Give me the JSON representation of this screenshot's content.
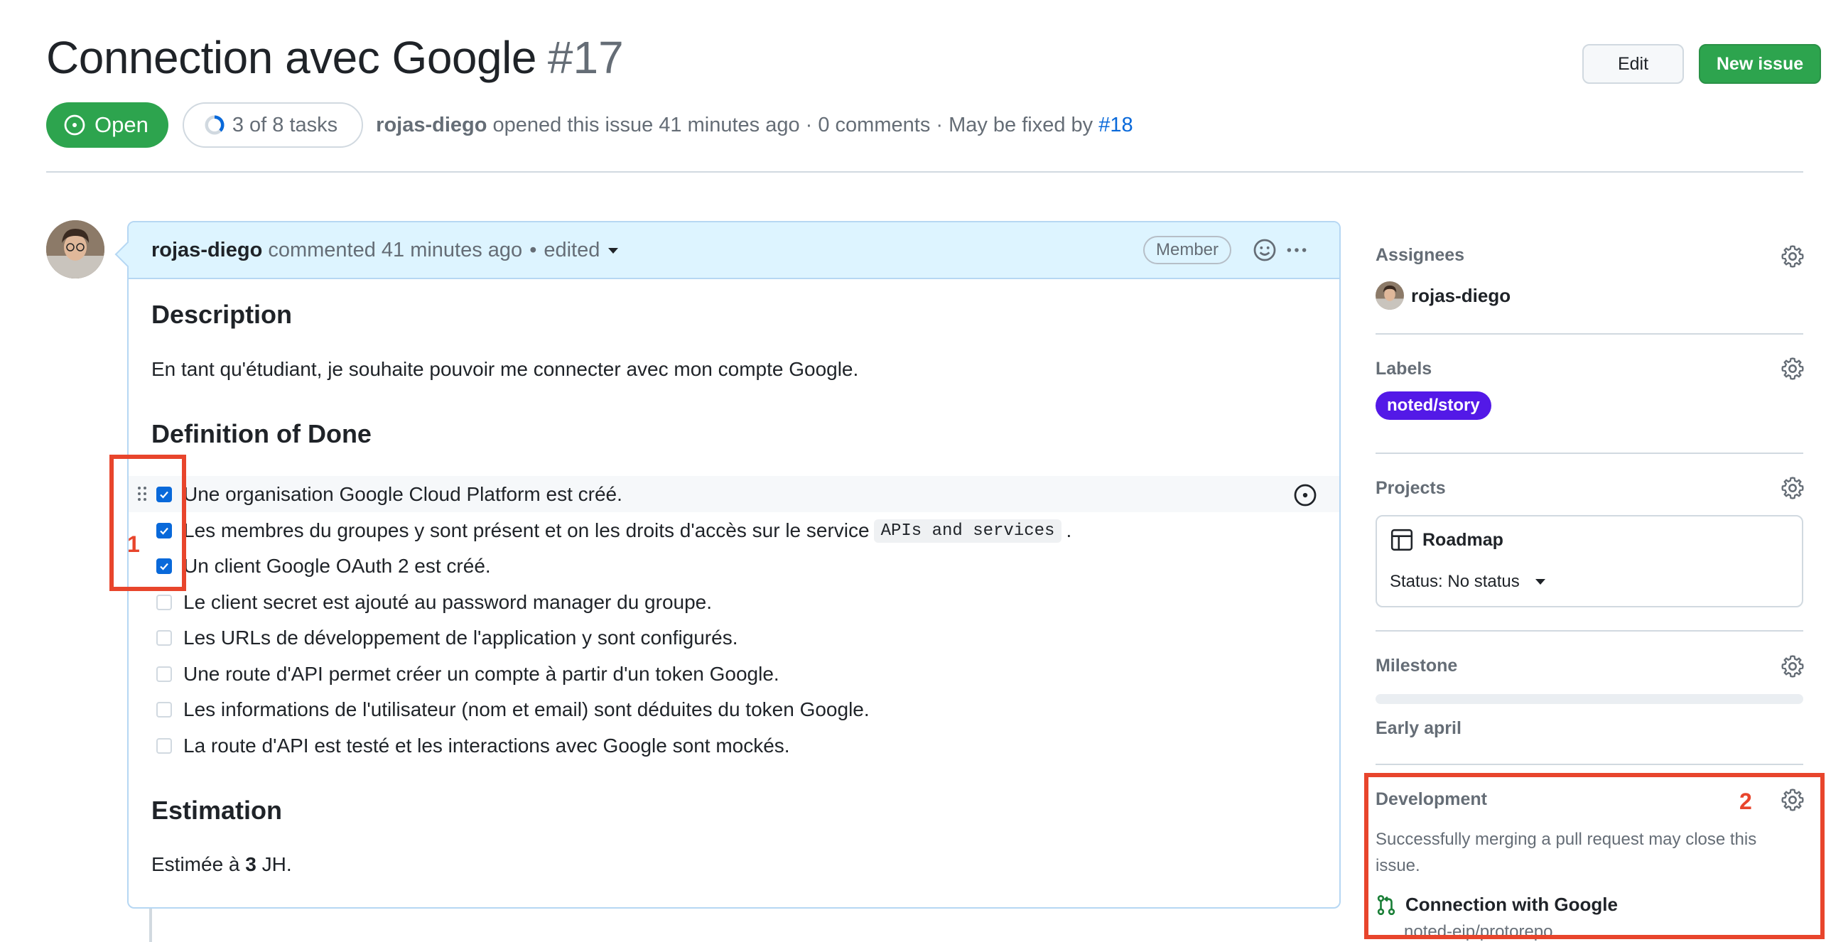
{
  "issue": {
    "title": "Connection avec Google",
    "number": "#17",
    "state": "Open",
    "tasks": "3 of 8 tasks",
    "tasks_done": 3,
    "tasks_total": 8,
    "author": "rojas-diego",
    "meta": "opened this issue 41 minutes ago · 0 comments · May be fixed by",
    "fixed_by": "#18"
  },
  "actions": {
    "edit": "Edit",
    "new_issue": "New issue"
  },
  "comment": {
    "author": "rojas-diego",
    "time": "commented 41 minutes ago",
    "separator": "•",
    "edited": "edited",
    "role": "Member",
    "description_heading": "Description",
    "description_text": "En tant qu'étudiant, je souhaite pouvoir me connecter avec mon compte Google.",
    "dod_heading": "Definition of Done",
    "tasks": [
      {
        "text": "Une organisation Google Cloud Platform est créé.",
        "checked": true
      },
      {
        "text": "Les membres du groupes y sont présent et on les droits d'accès sur le service",
        "code": "APIs and services",
        "suffix": ".",
        "checked": true
      },
      {
        "text": "Un client Google OAuth 2 est créé.",
        "checked": true
      },
      {
        "text": "Le client secret est ajouté au password manager du groupe.",
        "checked": false
      },
      {
        "text": "Les URLs de développement de l'application y sont configurés.",
        "checked": false
      },
      {
        "text": "Une route d'API permet créer un compte à partir d'un token Google.",
        "checked": false
      },
      {
        "text": "Les informations de l'utilisateur (nom et email) sont déduites du token Google.",
        "checked": false
      },
      {
        "text": "La route d'API est testé et les interactions avec Google sont mockés.",
        "checked": false
      }
    ],
    "estimation_heading": "Estimation",
    "estimation_prefix": "Estimée à ",
    "estimation_value": "3",
    "estimation_suffix": " JH."
  },
  "annotations": {
    "first": "1",
    "second": "2"
  },
  "sidebar": {
    "assignees": {
      "heading": "Assignees",
      "user": "rojas-diego"
    },
    "labels": {
      "heading": "Labels",
      "label": "noted/story",
      "label_color": "#5319e7"
    },
    "projects": {
      "heading": "Projects",
      "name": "Roadmap",
      "status": "Status: No status"
    },
    "milestone": {
      "heading": "Milestone",
      "name": "Early april",
      "progress": 0
    },
    "development": {
      "heading": "Development",
      "text": "Successfully merging a pull request may close this issue.",
      "pr_title": "Connection with Google",
      "pr_repo": "noted-eip/protorepo"
    }
  },
  "colors": {
    "open": "#2da44e",
    "link": "#0969da",
    "annotation": "#e8452c",
    "checkbox": "#0969da"
  }
}
